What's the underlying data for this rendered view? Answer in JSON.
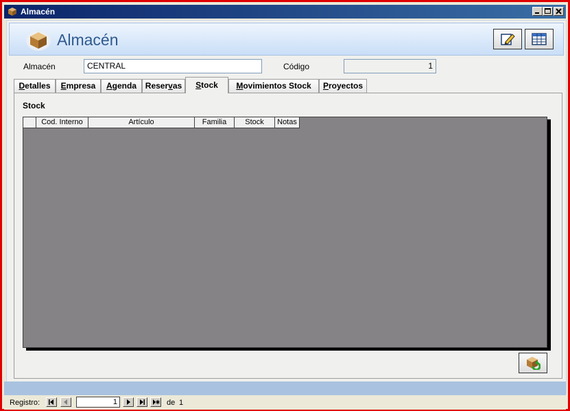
{
  "window": {
    "title": "Almacén"
  },
  "header": {
    "title": "Almacén"
  },
  "fields": {
    "almacen_label": "Almacén",
    "almacen_value": "CENTRAL",
    "codigo_label": "Código",
    "codigo_value": "1"
  },
  "tabs": [
    {
      "label": "Detalles",
      "underline": "D"
    },
    {
      "label": "Empresa",
      "underline": "E"
    },
    {
      "label": "Agenda",
      "underline": "A"
    },
    {
      "label": "Reservas",
      "underline": "v"
    },
    {
      "label": "Stock",
      "underline": "S",
      "active": true
    },
    {
      "label": "Movimientos Stock",
      "underline": "M"
    },
    {
      "label": "Proyectos",
      "underline": "P"
    }
  ],
  "stock": {
    "title": "Stock",
    "columns": [
      "",
      "Cod. Interno",
      "Artículo",
      "Familia",
      "Stock",
      "Notas"
    ],
    "rows": []
  },
  "navigation": {
    "label": "Registro:",
    "current": "1",
    "of_label": "de",
    "total": "1"
  },
  "colors": {
    "accent": "#2f5a8f",
    "grid_background": "#858385",
    "window_border": "#e00000"
  }
}
